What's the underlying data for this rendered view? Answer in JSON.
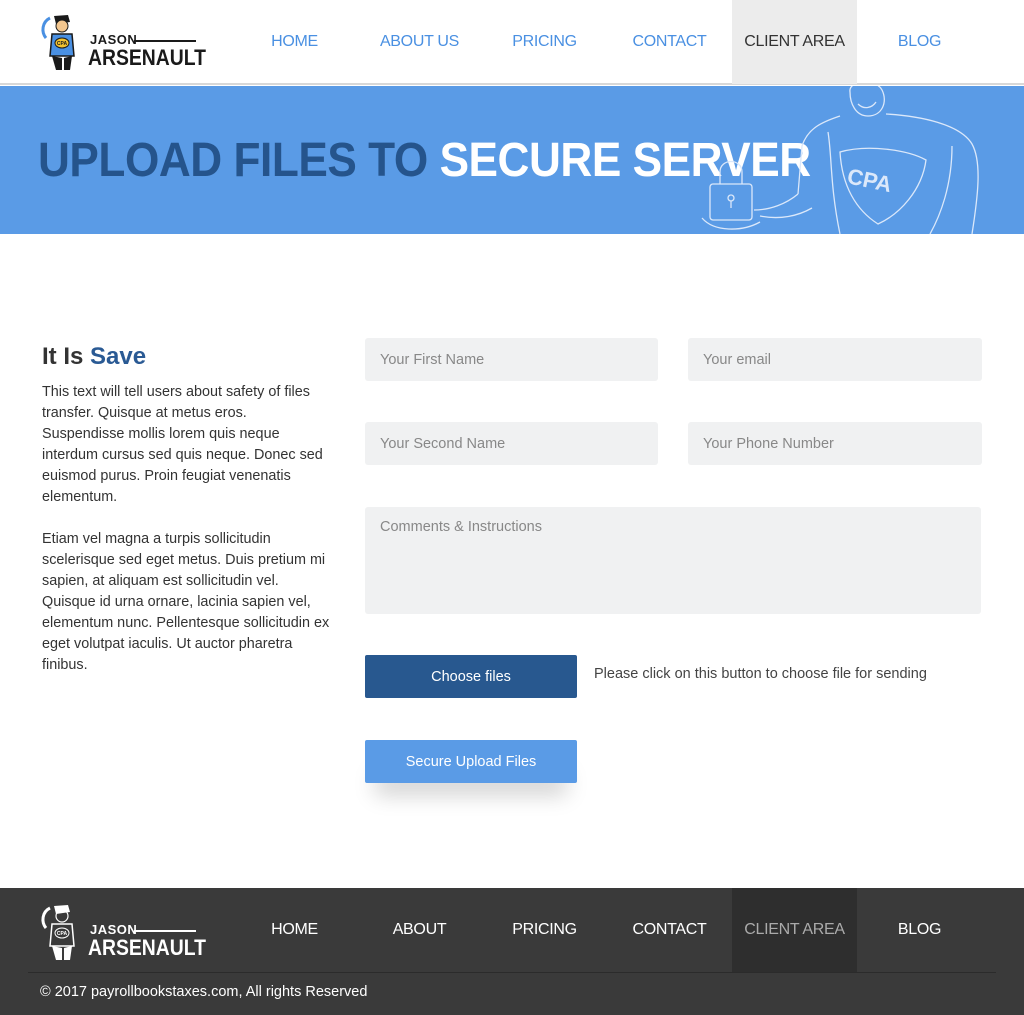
{
  "brand": {
    "first_name": "JASON",
    "last_name": "ARSENAULT",
    "badge": "CPA"
  },
  "nav": {
    "items": [
      {
        "label": "HOME"
      },
      {
        "label": "ABOUT US"
      },
      {
        "label": "PRICING"
      },
      {
        "label": "CONTACT"
      },
      {
        "label": "CLIENT AREA",
        "active": true
      },
      {
        "label": "BLOG"
      }
    ]
  },
  "banner": {
    "title_dark": "UPLOAD FILES TO",
    "title_light": "SECURE SERVER",
    "art_badge": "CPA"
  },
  "info": {
    "heading_prefix": "It Is",
    "heading_accent": "Save",
    "paragraph1": "This text will tell users about safety of files transfer. Quisque at metus eros. Suspendisse mollis lorem quis neque interdum cursus sed quis neque. Donec sed euismod purus. Proin feugiat venenatis elementum.",
    "paragraph2": "Etiam vel magna a turpis sollicitudin scelerisque sed eget metus. Duis pretium mi sapien, at aliquam est sollicitudin vel. Quisque id urna ornare, lacinia sapien vel, elementum nunc. Pellentesque sollicitudin ex eget volutpat iaculis. Ut auctor pharetra finibus."
  },
  "form": {
    "first_name": {
      "value": "",
      "placeholder": "Your First Name"
    },
    "email": {
      "value": "",
      "placeholder": "Your email"
    },
    "second_name": {
      "value": "",
      "placeholder": "Your Second Name"
    },
    "phone": {
      "value": "",
      "placeholder": "Your Phone Number"
    },
    "comments": {
      "value": "",
      "placeholder": "Comments & Instructions"
    },
    "choose_label": "Choose files",
    "choose_hint": "Please click on this button to choose file for sending",
    "upload_label": "Secure Upload Files"
  },
  "footer": {
    "nav": [
      {
        "label": "HOME"
      },
      {
        "label": "ABOUT"
      },
      {
        "label": "PRICING"
      },
      {
        "label": "CONTACT"
      },
      {
        "label": "CLIENT AREA",
        "active": true
      },
      {
        "label": "BLOG"
      }
    ],
    "copyright": "© 2017 payrollbookstaxes.com, All rights Reserved"
  },
  "colors": {
    "accent": "#4a90e2",
    "banner": "#5a9be6",
    "dark_blue": "#28588f",
    "footer_bg": "#3a3a3a"
  },
  "icons": [
    "logo-mascot-icon",
    "lock-icon",
    "cpa-hero-illustration"
  ]
}
